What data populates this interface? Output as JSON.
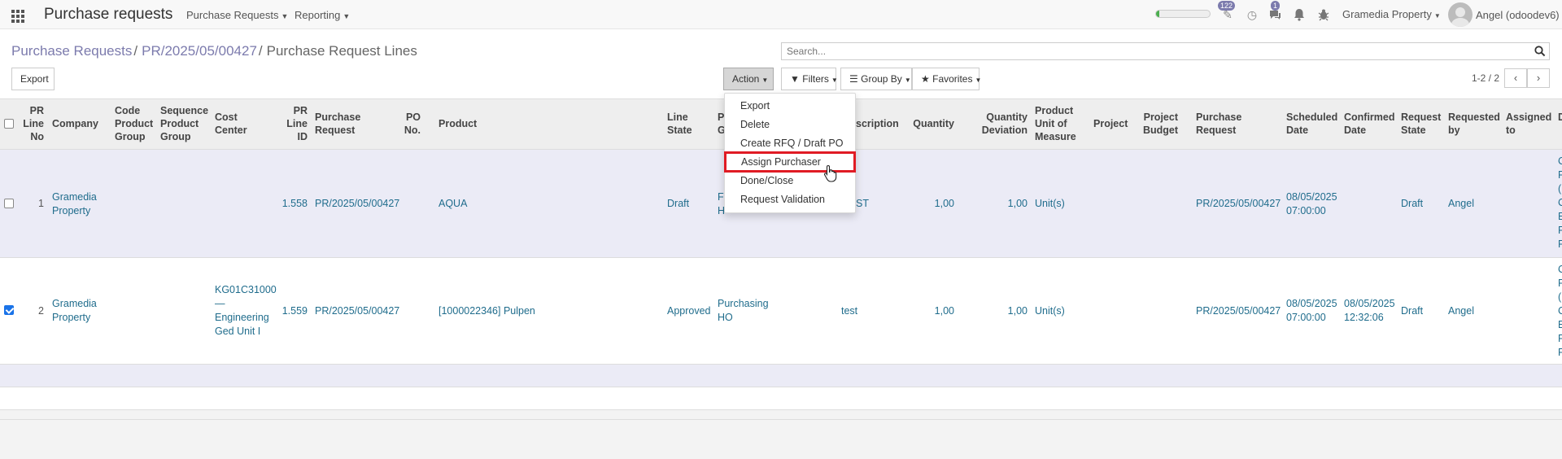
{
  "topbar": {
    "app_title": "Purchase requests",
    "menus": [
      "Purchase Requests",
      "Reporting"
    ],
    "progress_fraction": 0.06,
    "activity_badge": "122",
    "messages_badge": "1",
    "company": "Gramedia Property",
    "user": "Angel (odoodev6)"
  },
  "breadcrumb": {
    "items": [
      "Purchase Requests",
      "PR/2025/05/00427"
    ],
    "current": "Purchase Request Lines",
    "separator": "/"
  },
  "search": {
    "placeholder": "Search..."
  },
  "buttons": {
    "export": "Export",
    "action": "Action",
    "filters": "Filters",
    "group_by": "Group By",
    "favorites": "Favorites"
  },
  "pager": {
    "label": "1-2 / 2"
  },
  "columns": {
    "pr_line_no": [
      "PR",
      "Line",
      "No"
    ],
    "company": "Company",
    "code_product_group": [
      "Code",
      "Product",
      "Group"
    ],
    "sequence_product_group": [
      "Sequence",
      "Product",
      "Group"
    ],
    "cost_center": [
      "Cost",
      "Center"
    ],
    "pr_line_id": [
      "PR",
      "Line",
      "ID"
    ],
    "purchase_request": [
      "Purchase",
      "Request"
    ],
    "po_no": [
      "PO",
      "No."
    ],
    "product": "Product",
    "line_state": [
      "Line",
      "State"
    ],
    "purchasing_group": [
      "P",
      "G"
    ],
    "description": "scription",
    "quantity": "Quantity",
    "quantity_deviation": [
      "Quantity",
      "Deviation"
    ],
    "uom": [
      "Product",
      "Unit of",
      "Measure"
    ],
    "project": "Project",
    "project_budget": [
      "Project",
      "Budget"
    ],
    "purchase_request2": [
      "Purchase",
      "Request"
    ],
    "scheduled_date": [
      "Scheduled",
      "Date"
    ],
    "confirmed_date": [
      "Confirmed",
      "Date"
    ],
    "request_state": [
      "Request",
      "State"
    ],
    "requested_by": [
      "Requested",
      "by"
    ],
    "assigned_to": [
      "Assigned",
      "to"
    ],
    "last_col": "D"
  },
  "rows": [
    {
      "checked": false,
      "line_no": "1",
      "company": [
        "Gramedia",
        "Property"
      ],
      "cost_center": [],
      "pr_line_id": "1.558",
      "purchase_request": "PR/2025/05/00427",
      "product": "AQUA",
      "line_state": "Draft",
      "purchasing_group": [
        "F",
        "H"
      ],
      "description": "ST",
      "quantity": "1,00",
      "quantity_deviation": "1,00",
      "uom": "Unit(s)",
      "purchase_request2": "PR/2025/05/00427",
      "scheduled_date": [
        "08/05/2025",
        "07:00:00"
      ],
      "confirmed_date": [
        "",
        ""
      ],
      "request_state": "Draft",
      "requested_by": "Angel",
      "last_col": [
        "C",
        "F",
        "(",
        "C",
        "E",
        "F",
        "F"
      ]
    },
    {
      "checked": true,
      "line_no": "2",
      "company": [
        "Gramedia",
        "Property"
      ],
      "cost_center": [
        "KG01C31000",
        "—",
        "Engineering",
        "Ged Unit I"
      ],
      "pr_line_id": "1.559",
      "purchase_request": "PR/2025/05/00427",
      "product": "[1000022346] Pulpen",
      "line_state": "Approved",
      "purchasing_group": [
        "Purchasing",
        "HO"
      ],
      "description": "test",
      "quantity": "1,00",
      "quantity_deviation": "1,00",
      "uom": "Unit(s)",
      "purchase_request2": "PR/2025/05/00427",
      "scheduled_date": [
        "08/05/2025",
        "07:00:00"
      ],
      "confirmed_date": [
        "08/05/2025",
        "12:32:06"
      ],
      "request_state": "Draft",
      "requested_by": "Angel",
      "last_col": [
        "C",
        "F",
        "(",
        "C",
        "E",
        "F",
        "F"
      ]
    }
  ],
  "action_menu": {
    "items": [
      "Export",
      "Delete",
      "Create RFQ / Draft PO",
      "Assign Purchaser",
      "Done/Close",
      "Request Validation"
    ],
    "highlighted": "Assign Purchaser"
  },
  "colors": {
    "link": "#1f6c8c",
    "brand": "#7c7bad",
    "highlight": "#e01b24",
    "row_alt": "#ebebf6"
  }
}
